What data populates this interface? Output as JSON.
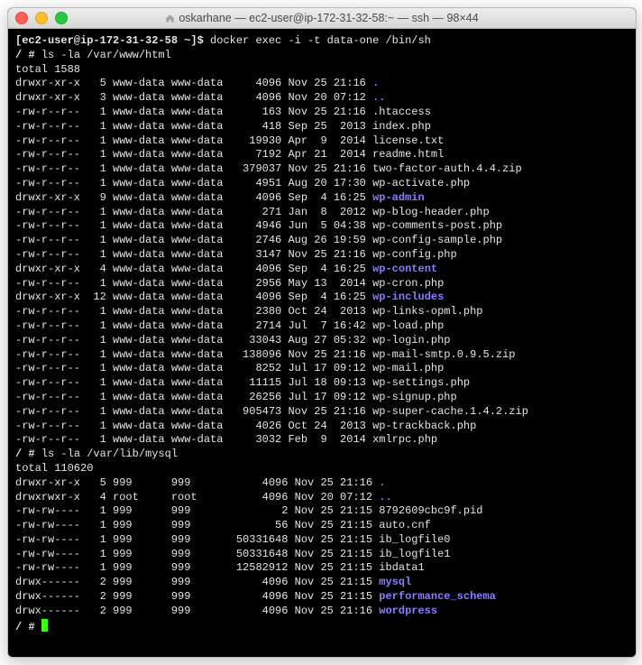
{
  "window": {
    "title": "oskarhane — ec2-user@ip-172-31-32-58:~ — ssh — 98×44"
  },
  "prompt1": "[ec2-user@ip-172-31-32-58 ~]$ ",
  "cmd1": "docker exec -i -t data-one /bin/sh",
  "prompt2": "/ # ",
  "cmd2": "ls -la /var/www/html",
  "total1": "total 1588",
  "html_list": [
    {
      "perm": "drwxr-xr-x",
      "links": "5",
      "user": "www-data",
      "group": "www-data",
      "size": "4096",
      "mon": "Nov",
      "day": "25",
      "time": "21:16",
      "name": ".",
      "dir": true
    },
    {
      "perm": "drwxr-xr-x",
      "links": "3",
      "user": "www-data",
      "group": "www-data",
      "size": "4096",
      "mon": "Nov",
      "day": "20",
      "time": "07:12",
      "name": "..",
      "dir": true
    },
    {
      "perm": "-rw-r--r--",
      "links": "1",
      "user": "www-data",
      "group": "www-data",
      "size": "163",
      "mon": "Nov",
      "day": "25",
      "time": "21:16",
      "name": ".htaccess",
      "dir": false
    },
    {
      "perm": "-rw-r--r--",
      "links": "1",
      "user": "www-data",
      "group": "www-data",
      "size": "418",
      "mon": "Sep",
      "day": "25",
      "time": "2013",
      "name": "index.php",
      "dir": false
    },
    {
      "perm": "-rw-r--r--",
      "links": "1",
      "user": "www-data",
      "group": "www-data",
      "size": "19930",
      "mon": "Apr",
      "day": "9",
      "time": "2014",
      "name": "license.txt",
      "dir": false
    },
    {
      "perm": "-rw-r--r--",
      "links": "1",
      "user": "www-data",
      "group": "www-data",
      "size": "7192",
      "mon": "Apr",
      "day": "21",
      "time": "2014",
      "name": "readme.html",
      "dir": false
    },
    {
      "perm": "-rw-r--r--",
      "links": "1",
      "user": "www-data",
      "group": "www-data",
      "size": "379037",
      "mon": "Nov",
      "day": "25",
      "time": "21:16",
      "name": "two-factor-auth.4.4.zip",
      "dir": false
    },
    {
      "perm": "-rw-r--r--",
      "links": "1",
      "user": "www-data",
      "group": "www-data",
      "size": "4951",
      "mon": "Aug",
      "day": "20",
      "time": "17:30",
      "name": "wp-activate.php",
      "dir": false
    },
    {
      "perm": "drwxr-xr-x",
      "links": "9",
      "user": "www-data",
      "group": "www-data",
      "size": "4096",
      "mon": "Sep",
      "day": "4",
      "time": "16:25",
      "name": "wp-admin",
      "dir": true
    },
    {
      "perm": "-rw-r--r--",
      "links": "1",
      "user": "www-data",
      "group": "www-data",
      "size": "271",
      "mon": "Jan",
      "day": "8",
      "time": "2012",
      "name": "wp-blog-header.php",
      "dir": false
    },
    {
      "perm": "-rw-r--r--",
      "links": "1",
      "user": "www-data",
      "group": "www-data",
      "size": "4946",
      "mon": "Jun",
      "day": "5",
      "time": "04:38",
      "name": "wp-comments-post.php",
      "dir": false
    },
    {
      "perm": "-rw-r--r--",
      "links": "1",
      "user": "www-data",
      "group": "www-data",
      "size": "2746",
      "mon": "Aug",
      "day": "26",
      "time": "19:59",
      "name": "wp-config-sample.php",
      "dir": false
    },
    {
      "perm": "-rw-r--r--",
      "links": "1",
      "user": "www-data",
      "group": "www-data",
      "size": "3147",
      "mon": "Nov",
      "day": "25",
      "time": "21:16",
      "name": "wp-config.php",
      "dir": false
    },
    {
      "perm": "drwxr-xr-x",
      "links": "4",
      "user": "www-data",
      "group": "www-data",
      "size": "4096",
      "mon": "Sep",
      "day": "4",
      "time": "16:25",
      "name": "wp-content",
      "dir": true
    },
    {
      "perm": "-rw-r--r--",
      "links": "1",
      "user": "www-data",
      "group": "www-data",
      "size": "2956",
      "mon": "May",
      "day": "13",
      "time": "2014",
      "name": "wp-cron.php",
      "dir": false
    },
    {
      "perm": "drwxr-xr-x",
      "links": "12",
      "user": "www-data",
      "group": "www-data",
      "size": "4096",
      "mon": "Sep",
      "day": "4",
      "time": "16:25",
      "name": "wp-includes",
      "dir": true
    },
    {
      "perm": "-rw-r--r--",
      "links": "1",
      "user": "www-data",
      "group": "www-data",
      "size": "2380",
      "mon": "Oct",
      "day": "24",
      "time": "2013",
      "name": "wp-links-opml.php",
      "dir": false
    },
    {
      "perm": "-rw-r--r--",
      "links": "1",
      "user": "www-data",
      "group": "www-data",
      "size": "2714",
      "mon": "Jul",
      "day": "7",
      "time": "16:42",
      "name": "wp-load.php",
      "dir": false
    },
    {
      "perm": "-rw-r--r--",
      "links": "1",
      "user": "www-data",
      "group": "www-data",
      "size": "33043",
      "mon": "Aug",
      "day": "27",
      "time": "05:32",
      "name": "wp-login.php",
      "dir": false
    },
    {
      "perm": "-rw-r--r--",
      "links": "1",
      "user": "www-data",
      "group": "www-data",
      "size": "138096",
      "mon": "Nov",
      "day": "25",
      "time": "21:16",
      "name": "wp-mail-smtp.0.9.5.zip",
      "dir": false
    },
    {
      "perm": "-rw-r--r--",
      "links": "1",
      "user": "www-data",
      "group": "www-data",
      "size": "8252",
      "mon": "Jul",
      "day": "17",
      "time": "09:12",
      "name": "wp-mail.php",
      "dir": false
    },
    {
      "perm": "-rw-r--r--",
      "links": "1",
      "user": "www-data",
      "group": "www-data",
      "size": "11115",
      "mon": "Jul",
      "day": "18",
      "time": "09:13",
      "name": "wp-settings.php",
      "dir": false
    },
    {
      "perm": "-rw-r--r--",
      "links": "1",
      "user": "www-data",
      "group": "www-data",
      "size": "26256",
      "mon": "Jul",
      "day": "17",
      "time": "09:12",
      "name": "wp-signup.php",
      "dir": false
    },
    {
      "perm": "-rw-r--r--",
      "links": "1",
      "user": "www-data",
      "group": "www-data",
      "size": "905473",
      "mon": "Nov",
      "day": "25",
      "time": "21:16",
      "name": "wp-super-cache.1.4.2.zip",
      "dir": false
    },
    {
      "perm": "-rw-r--r--",
      "links": "1",
      "user": "www-data",
      "group": "www-data",
      "size": "4026",
      "mon": "Oct",
      "day": "24",
      "time": "2013",
      "name": "wp-trackback.php",
      "dir": false
    },
    {
      "perm": "-rw-r--r--",
      "links": "1",
      "user": "www-data",
      "group": "www-data",
      "size": "3032",
      "mon": "Feb",
      "day": "9",
      "time": "2014",
      "name": "xmlrpc.php",
      "dir": false
    }
  ],
  "prompt3": "/ # ",
  "cmd3": "ls -la /var/lib/mysql",
  "total2": "total 110620",
  "mysql_list": [
    {
      "perm": "drwxr-xr-x",
      "links": "5",
      "user": "999",
      "group": "999",
      "size": "4096",
      "mon": "Nov",
      "day": "25",
      "time": "21:16",
      "name": ".",
      "dir": true
    },
    {
      "perm": "drwxrwxr-x",
      "links": "4",
      "user": "root",
      "group": "root",
      "size": "4096",
      "mon": "Nov",
      "day": "20",
      "time": "07:12",
      "name": "..",
      "dir": true
    },
    {
      "perm": "-rw-rw----",
      "links": "1",
      "user": "999",
      "group": "999",
      "size": "2",
      "mon": "Nov",
      "day": "25",
      "time": "21:15",
      "name": "8792609cbc9f.pid",
      "dir": false
    },
    {
      "perm": "-rw-rw----",
      "links": "1",
      "user": "999",
      "group": "999",
      "size": "56",
      "mon": "Nov",
      "day": "25",
      "time": "21:15",
      "name": "auto.cnf",
      "dir": false
    },
    {
      "perm": "-rw-rw----",
      "links": "1",
      "user": "999",
      "group": "999",
      "size": "50331648",
      "mon": "Nov",
      "day": "25",
      "time": "21:15",
      "name": "ib_logfile0",
      "dir": false
    },
    {
      "perm": "-rw-rw----",
      "links": "1",
      "user": "999",
      "group": "999",
      "size": "50331648",
      "mon": "Nov",
      "day": "25",
      "time": "21:15",
      "name": "ib_logfile1",
      "dir": false
    },
    {
      "perm": "-rw-rw----",
      "links": "1",
      "user": "999",
      "group": "999",
      "size": "12582912",
      "mon": "Nov",
      "day": "25",
      "time": "21:15",
      "name": "ibdata1",
      "dir": false
    },
    {
      "perm": "drwx------",
      "links": "2",
      "user": "999",
      "group": "999",
      "size": "4096",
      "mon": "Nov",
      "day": "25",
      "time": "21:15",
      "name": "mysql",
      "dir": true
    },
    {
      "perm": "drwx------",
      "links": "2",
      "user": "999",
      "group": "999",
      "size": "4096",
      "mon": "Nov",
      "day": "25",
      "time": "21:15",
      "name": "performance_schema",
      "dir": true
    },
    {
      "perm": "drwx------",
      "links": "2",
      "user": "999",
      "group": "999",
      "size": "4096",
      "mon": "Nov",
      "day": "25",
      "time": "21:16",
      "name": "wordpress",
      "dir": true
    }
  ],
  "prompt4": "/ # "
}
